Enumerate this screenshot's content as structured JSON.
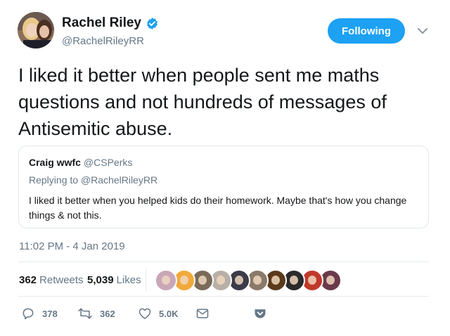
{
  "author": {
    "name": "Rachel Riley",
    "handle": "@RachelRileyRR"
  },
  "follow_button": {
    "label": "Following"
  },
  "tweet_text": "I liked it better when people sent me maths questions and not hundreds of messages of Antisemitic abuse.",
  "quoted_tweet": {
    "name": "Craig wwfc",
    "handle": "@CSPerks",
    "replying_to": "Replying to @RachelRileyRR",
    "text": "I liked it better when you helped kids do their homework. Maybe that's how you change things & not this."
  },
  "timestamp": "11:02 PM - 4 Jan 2019",
  "stats": {
    "retweets_count": "362",
    "retweets_label": "Retweets",
    "likes_count": "5,039",
    "likes_label": "Likes"
  },
  "liker_avatar_colors": [
    "#c9a7b8",
    "#f2a93b",
    "#7a6a5a",
    "#b8b0a8",
    "#3b3b4a",
    "#8a7a6a",
    "#5a3a1a",
    "#2a2a2a",
    "#c0392b",
    "#6a3a4a"
  ],
  "actions": {
    "reply_count": "378",
    "retweet_count": "362",
    "like_count": "5.0K"
  },
  "colors": {
    "accent": "#1da1f2",
    "secondary_text": "#657786",
    "border": "#e1e8ed"
  }
}
